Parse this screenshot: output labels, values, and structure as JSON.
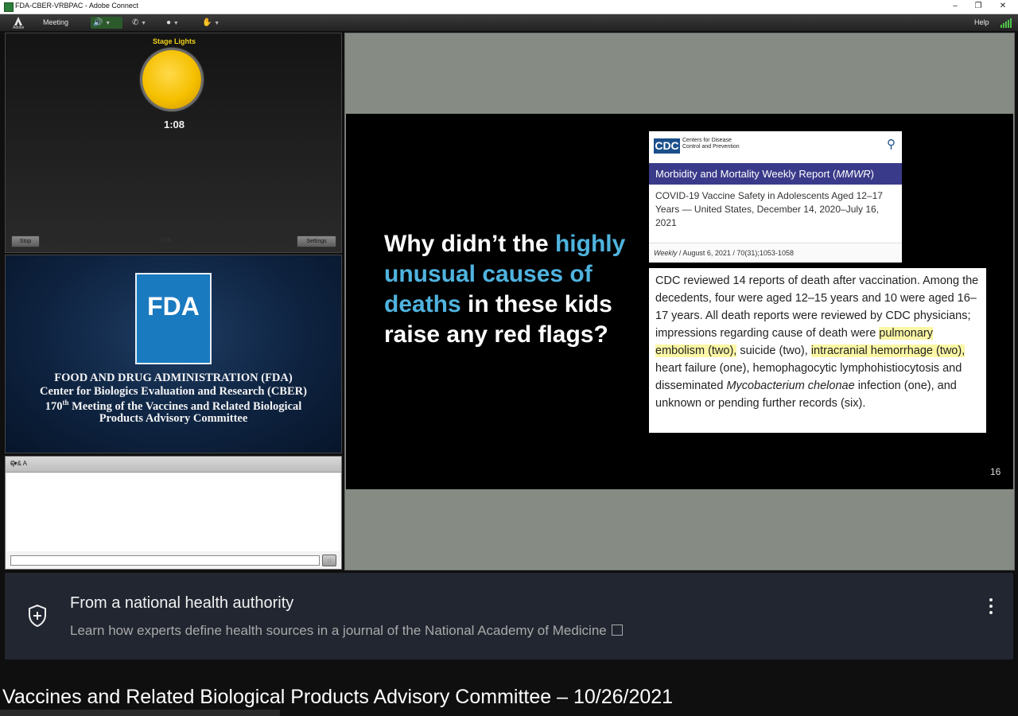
{
  "window": {
    "title": "FDA-CBER-VRBPAC - Adobe Connect",
    "controls": [
      "minimize",
      "restore",
      "close"
    ]
  },
  "menubar": {
    "logo_label": "Adobe",
    "meeting_label": "Meeting",
    "help_label": "Help",
    "icons": [
      "speaker-icon",
      "phone-icon",
      "camera-icon",
      "hand-raise-icon",
      "signal-icon"
    ]
  },
  "stage_lights": {
    "title": "Stage Lights",
    "timer": "1:08",
    "light_color": "#f5c000",
    "stop_label": "Stop",
    "settings_label": "Settings"
  },
  "fda_pod": {
    "logo_text": "FDA",
    "lines": [
      "FOOD AND DRUG ADMINISTRATION (FDA)",
      "Center for Biologics Evaluation and Research (CBER)",
      "170",
      "th",
      " Meeting of the Vaccines and Related Biological",
      "Products Advisory Committee"
    ]
  },
  "qa": {
    "title": "Q & A"
  },
  "slide": {
    "question_parts": [
      "Why didn’t the ",
      "highly unusual causes of deaths",
      " in these kids raise any red flags?"
    ],
    "highlight_color": "#4fb3de",
    "cdc_badge": "CDC",
    "cdc_name_line1": "Centers for Disease",
    "cdc_name_line2": "Control and Prevention",
    "mmwr_header": "Morbidity and Mortality Weekly Report (",
    "mmwr_abbrev": "MMWR",
    "mmwr_close": ")",
    "article_title": "COVID-19 Vaccine Safety in Adolescents Aged 12–17 Years — United States, December 14, 2020–July 16, 2021",
    "citation_italic": "Weekly",
    "citation_rest": " / August 6, 2021 / 70(31);1053-1058",
    "quote": {
      "part1": "CDC reviewed 14 reports of death after vaccination. Among the decedents, four were aged 12–15 years and 10 were aged 16–17 years. All death reports were reviewed by CDC physicians; impressions regarding cause of death were ",
      "hl1": "pulmonary embolism (two),",
      "part2": " suicide (two), ",
      "hl2": "intracranial hemorrhage (two),",
      "part3": " heart failure (one), hemophagocytic lymphohistiocytosis and disseminated ",
      "italic": "Mycobacterium chelonae",
      "part4": " infection (one), and unknown or pending further records (six)."
    },
    "page_number": "16"
  },
  "info_panel": {
    "title": "From a national health authority",
    "link_text": "Learn how experts define health sources in a journal of the National Academy of Medicine"
  },
  "video": {
    "title": "Vaccines and Related Biological Products Advisory Committee – 10/26/2021"
  }
}
